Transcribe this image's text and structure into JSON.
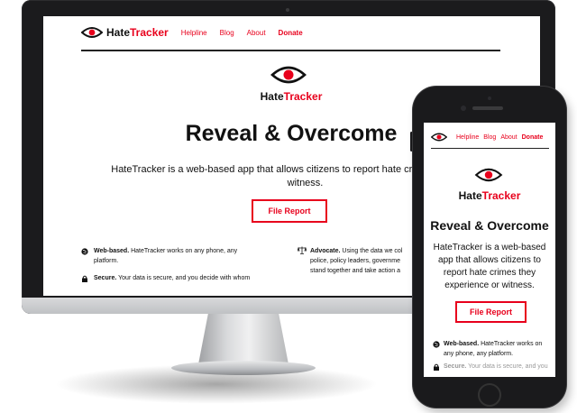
{
  "brand": {
    "prefix": "Hate",
    "suffix": "Tracker",
    "accent_color": "#e8001c"
  },
  "nav": {
    "helpline": "Helpline",
    "blog": "Blog",
    "about": "About",
    "donate": "Donate"
  },
  "hero": {
    "title": "Reveal & Overcome",
    "desktop_subtitle_line1": "HateTracker is a web-based app that allows citizens to report hate crimes th",
    "desktop_subtitle_line2": "witness.",
    "mobile_subtitle": "HateTracker is a web-based app that allows citizens to report hate crimes they experience or witness.",
    "button": "File Report"
  },
  "features": {
    "web_title": "Web-based.",
    "web_text_desktop_1": "HateTracker works on any phone, any",
    "web_text_desktop_2": "platform.",
    "web_text_mobile": "HateTracker works on any phone, any platform.",
    "secure_title": "Secure.",
    "secure_text_desktop": "Your data is secure, and you decide with whom",
    "secure_text_mobile": "Your data is secure, and you",
    "advocate_title": "Advocate.",
    "advocate_text_1": "Using the data we col",
    "advocate_text_2": "police, policy leaders, governme",
    "advocate_text_3": "stand together and take action a"
  },
  "icons": {
    "logo": "eye-icon",
    "web": "globe-icon",
    "advocate": "scales-icon",
    "secure": "lock-icon"
  }
}
